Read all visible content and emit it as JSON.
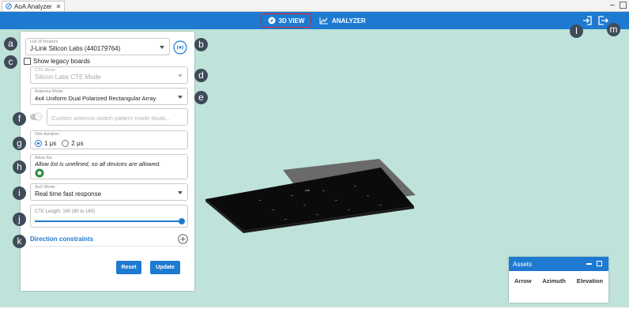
{
  "window": {
    "tab_title": "AoA Analyzer",
    "close_glyph": "✕"
  },
  "header": {
    "nav": [
      {
        "label": "3D VIEW",
        "icon": "compass-icon",
        "active": true
      },
      {
        "label": "ANALYZER",
        "icon": "chart-line-icon",
        "active": false
      }
    ],
    "actions": [
      {
        "icon": "login-icon"
      },
      {
        "icon": "logout-icon"
      }
    ],
    "color": "#1e7ad1"
  },
  "panel": {
    "locator": {
      "label": "List of locators",
      "value": "J-Link Silicon Labs (440179764)"
    },
    "legacy": {
      "label": "Show legacy boards",
      "checked": false
    },
    "cte_mode": {
      "label": "CTE Mode",
      "value": "Silicon Labs CTE Mode",
      "disabled": true
    },
    "antenna": {
      "label": "Antenna Mode",
      "value": "4x4 Uniform Dual Polarized Rectangular Array"
    },
    "custom_switch": {
      "placeholder": "Custom antenna switch pattern mode disab...",
      "enabled": false
    },
    "slot": {
      "label": "Slot duration",
      "options": [
        "1 μs",
        "2 μs"
      ],
      "selected": "1 μs"
    },
    "allow": {
      "label": "Allow list",
      "text": "Allow list is unefined, so all devices are allowed."
    },
    "aox": {
      "label": "AoX Mode",
      "value": "Real time fast response"
    },
    "cte_length": {
      "label": "CTE Length: 160 (80 to 160)",
      "value": 160,
      "min": 80,
      "max": 160
    },
    "direction": {
      "label": "Direction constraints"
    },
    "buttons": {
      "reset": "Reset",
      "update": "Update"
    }
  },
  "callouts": {
    "a": "a",
    "b": "b",
    "c": "c",
    "d": "d",
    "e": "e",
    "f": "f",
    "g": "g",
    "h": "h",
    "i": "i",
    "j": "j",
    "k": "k",
    "l": "l",
    "m": "m"
  },
  "assets": {
    "title": "Assets",
    "columns": [
      "Arrow",
      "Azimuth",
      "Elevation"
    ]
  },
  "colors": {
    "viewport": "#bfe3da",
    "accent": "#1e7ad1",
    "callout": "#3f4b59"
  }
}
